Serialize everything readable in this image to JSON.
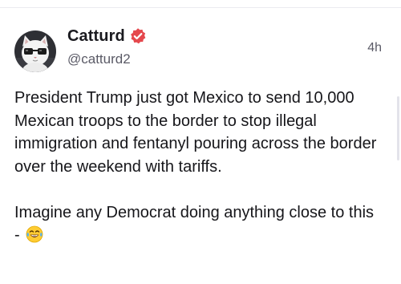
{
  "post": {
    "author": {
      "display_name": "Catturd",
      "handle": "@catturd2",
      "verified": true,
      "verified_icon": "verified-badge-icon",
      "verified_color": "#e5484d",
      "avatar_icon": "cat-with-glasses-avatar"
    },
    "timestamp": "4h",
    "paragraphs": [
      "President Trump just got Mexico to send 10,000 Mexican troops to the border to stop illegal immigration and fentanyl pouring across the border over the weekend with tariffs.",
      "Imagine any Democrat doing anything close to this - "
    ],
    "emoji": "face-with-tears-of-joy-emoji"
  },
  "colors": {
    "text_primary": "#16161a",
    "text_secondary": "#5a5a66",
    "divider": "#ebebef",
    "background": "#ffffff"
  }
}
